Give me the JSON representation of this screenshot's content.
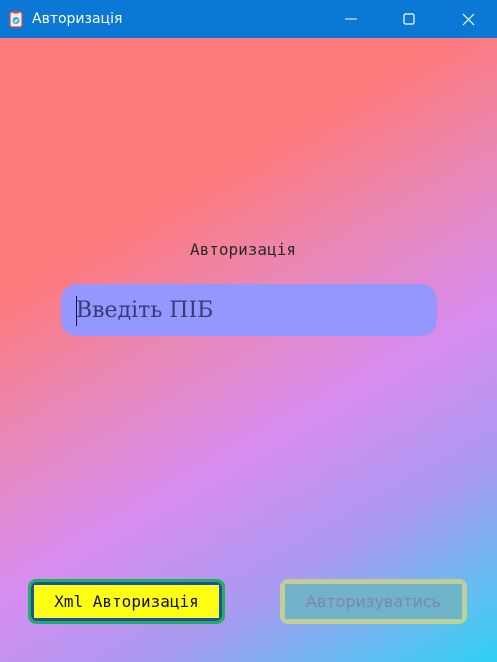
{
  "window": {
    "title": "Авторизація",
    "controls": {
      "minimize": "minimize-icon",
      "maximize": "maximize-icon",
      "close": "close-icon"
    },
    "titlebar_color": "#0a78d4"
  },
  "form": {
    "heading": "Авторизація",
    "name_input": {
      "placeholder": "Введіть ПІБ",
      "value": ""
    },
    "xml_button_label": "Xml Авторизація",
    "login_button_label": "Авторизуватись",
    "login_button_enabled": false
  },
  "colors": {
    "gradient_start": "#ff7a7a",
    "gradient_mid": "#d68cf2",
    "gradient_end": "#2fd0f2",
    "input_bg": "#9597ff",
    "xml_button_bg": "#ffff14",
    "xml_button_border_outer": "#22b05f",
    "xml_button_border_inner": "#1d4fa8",
    "login_button_bg": "#6fb4c4",
    "login_button_border": "#c8d28e"
  }
}
